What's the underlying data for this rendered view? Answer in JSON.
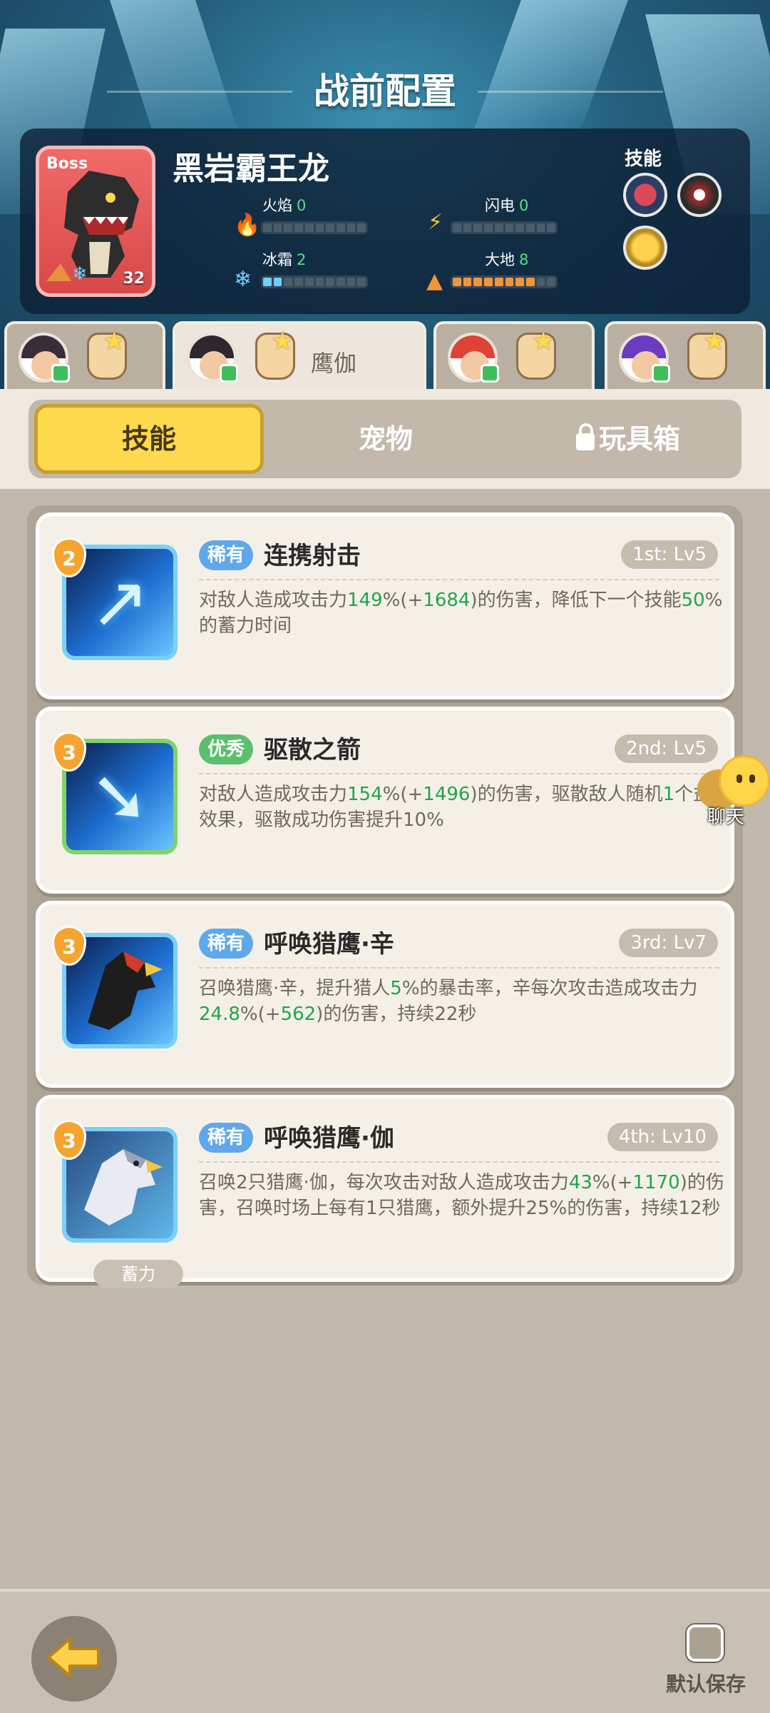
{
  "header": {
    "title": "战前配置"
  },
  "boss": {
    "tag": "Boss",
    "name": "黑岩霸王龙",
    "level": "32",
    "skills_label": "技能",
    "stats": [
      {
        "label": "火焰",
        "value": "0",
        "icon": "fire-icon",
        "color": "#e24a3a",
        "filled": 0
      },
      {
        "label": "闪电",
        "value": "0",
        "icon": "lightning-icon",
        "color": "#f5c431",
        "filled": 0
      },
      {
        "label": "冰霜",
        "value": "2",
        "icon": "frost-icon",
        "color": "#6fd0ff",
        "filled": 2
      },
      {
        "label": "大地",
        "value": "8",
        "icon": "earth-icon",
        "color": "#f2953a",
        "filled": 8
      }
    ],
    "stat_max": 10
  },
  "heroes": [
    {
      "name": "",
      "active": false
    },
    {
      "name": "鹰伽",
      "active": true
    },
    {
      "name": "",
      "active": false
    },
    {
      "name": "",
      "active": false
    }
  ],
  "tabs": {
    "skills": "技能",
    "pets": "宠物",
    "toys": "玩具箱"
  },
  "skills": [
    {
      "cost": "2",
      "rarity": "稀有",
      "name": "连携射击",
      "level": "1st: Lv5",
      "desc": [
        {
          "t": "对敌人造成攻击力"
        },
        {
          "t": "149",
          "hl": true
        },
        {
          "t": "%(+"
        },
        {
          "t": "1684",
          "hl": true
        },
        {
          "t": ")的伤害，降低下一个技能"
        },
        {
          "t": "50",
          "hl": true
        },
        {
          "t": "%的蓄力时间"
        }
      ]
    },
    {
      "cost": "3",
      "rarity": "优秀",
      "name": "驱散之箭",
      "level": "2nd: Lv5",
      "desc": [
        {
          "t": "对敌人造成攻击力"
        },
        {
          "t": "154",
          "hl": true
        },
        {
          "t": "%(+"
        },
        {
          "t": "1496",
          "hl": true
        },
        {
          "t": ")的伤害，驱散敌人随机"
        },
        {
          "t": "1",
          "hl": true
        },
        {
          "t": "个"
        },
        {
          "t": "益效果，驱散成功伤害提升10%"
        }
      ]
    },
    {
      "cost": "3",
      "rarity": "稀有",
      "name": "呼唤猎鹰·辛",
      "level": "3rd: Lv7",
      "desc": [
        {
          "t": "召唤猎鹰·辛，提升猎人"
        },
        {
          "t": "5",
          "hl": true
        },
        {
          "t": "%的暴击率，辛每次攻击造成攻击力"
        },
        {
          "t": "24.8",
          "hl": true
        },
        {
          "t": "%(+"
        },
        {
          "t": "562",
          "hl": true
        },
        {
          "t": ")的伤害，持续22秒"
        }
      ]
    },
    {
      "cost": "3",
      "rarity": "稀有",
      "name": "呼唤猎鹰·伽",
      "level": "4th: Lv10",
      "charge": "蓄力",
      "desc": [
        {
          "t": "召唤2只猎鹰·伽，每次攻击对敌人造成攻击力"
        },
        {
          "t": "43",
          "hl": true
        },
        {
          "t": "%(+"
        },
        {
          "t": "1170",
          "hl": true
        },
        {
          "t": ")的伤害，召唤时场上每有1只猎鹰，额外提升25%的伤害，持续12秒"
        }
      ]
    }
  ],
  "chat": {
    "label": "聊天"
  },
  "footer": {
    "save_label": "默认保存",
    "save_checked": false
  }
}
